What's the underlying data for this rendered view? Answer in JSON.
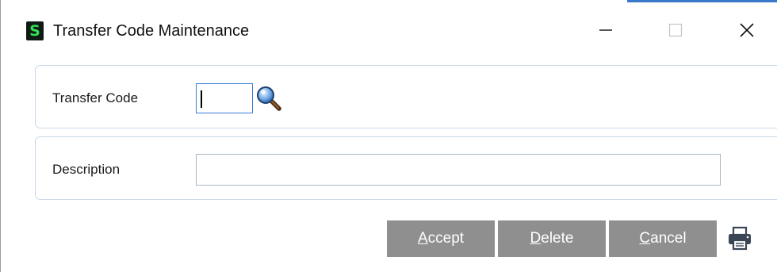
{
  "window": {
    "title": "Transfer Code Maintenance",
    "app_icon_letter": "S"
  },
  "form": {
    "transfer_code": {
      "label": "Transfer Code",
      "value": ""
    },
    "description": {
      "label": "Description",
      "value": ""
    }
  },
  "buttons": {
    "accept": {
      "underline": "A",
      "rest": "ccept"
    },
    "delete": {
      "underline": "D",
      "rest": "elete"
    },
    "cancel": {
      "underline": "C",
      "rest": "ancel"
    }
  },
  "icons": {
    "app": "sage-s-icon",
    "lookup": "magnifier-icon",
    "print": "printer-icon",
    "minimize": "minimize-icon",
    "maximize": "maximize-icon",
    "close": "close-icon"
  },
  "colors": {
    "button_bg": "#8f8f8f",
    "focus_border": "#3d7fd6",
    "panel_border": "#c9d7e8",
    "app_icon_bg": "#0f1a12",
    "app_icon_fg": "#2fe05a"
  }
}
